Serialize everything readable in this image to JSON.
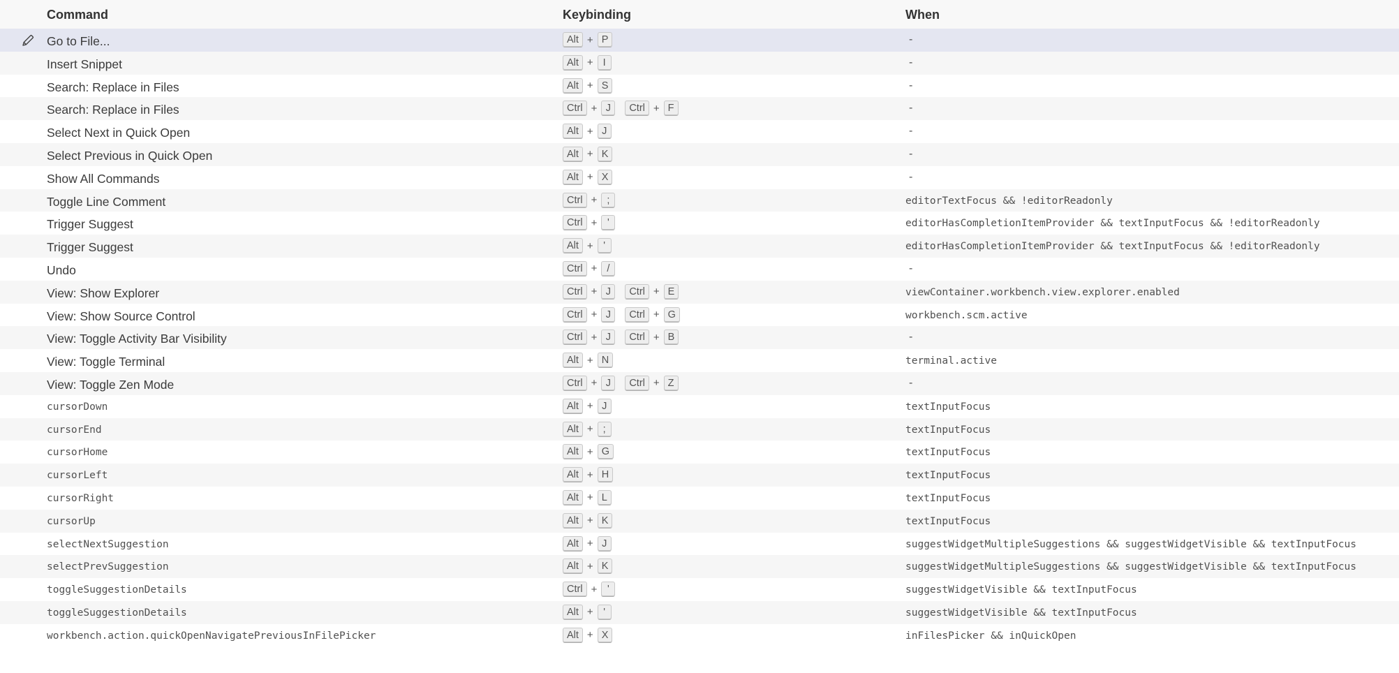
{
  "header": {
    "command": "Command",
    "keybinding": "Keybinding",
    "when": "When"
  },
  "rows": [
    {
      "command": "Go to File...",
      "mono": false,
      "chords": [
        [
          "Alt",
          "P"
        ]
      ],
      "when": "-"
    },
    {
      "command": "Insert Snippet",
      "mono": false,
      "chords": [
        [
          "Alt",
          "I"
        ]
      ],
      "when": "-"
    },
    {
      "command": "Search: Replace in Files",
      "mono": false,
      "chords": [
        [
          "Alt",
          "S"
        ]
      ],
      "when": "-"
    },
    {
      "command": "Search: Replace in Files",
      "mono": false,
      "chords": [
        [
          "Ctrl",
          "J"
        ],
        [
          "Ctrl",
          "F"
        ]
      ],
      "when": "-"
    },
    {
      "command": "Select Next in Quick Open",
      "mono": false,
      "chords": [
        [
          "Alt",
          "J"
        ]
      ],
      "when": "-"
    },
    {
      "command": "Select Previous in Quick Open",
      "mono": false,
      "chords": [
        [
          "Alt",
          "K"
        ]
      ],
      "when": "-"
    },
    {
      "command": "Show All Commands",
      "mono": false,
      "chords": [
        [
          "Alt",
          "X"
        ]
      ],
      "when": "-"
    },
    {
      "command": "Toggle Line Comment",
      "mono": false,
      "chords": [
        [
          "Ctrl",
          ";"
        ]
      ],
      "when": "editorTextFocus && !editorReadonly"
    },
    {
      "command": "Trigger Suggest",
      "mono": false,
      "chords": [
        [
          "Ctrl",
          "'"
        ]
      ],
      "when": "editorHasCompletionItemProvider && textInputFocus && !editorReadonly"
    },
    {
      "command": "Trigger Suggest",
      "mono": false,
      "chords": [
        [
          "Alt",
          "'"
        ]
      ],
      "when": "editorHasCompletionItemProvider && textInputFocus && !editorReadonly"
    },
    {
      "command": "Undo",
      "mono": false,
      "chords": [
        [
          "Ctrl",
          "/"
        ]
      ],
      "when": "-"
    },
    {
      "command": "View: Show Explorer",
      "mono": false,
      "chords": [
        [
          "Ctrl",
          "J"
        ],
        [
          "Ctrl",
          "E"
        ]
      ],
      "when": "viewContainer.workbench.view.explorer.enabled"
    },
    {
      "command": "View: Show Source Control",
      "mono": false,
      "chords": [
        [
          "Ctrl",
          "J"
        ],
        [
          "Ctrl",
          "G"
        ]
      ],
      "when": "workbench.scm.active"
    },
    {
      "command": "View: Toggle Activity Bar Visibility",
      "mono": false,
      "chords": [
        [
          "Ctrl",
          "J"
        ],
        [
          "Ctrl",
          "B"
        ]
      ],
      "when": "-"
    },
    {
      "command": "View: Toggle Terminal",
      "mono": false,
      "chords": [
        [
          "Alt",
          "N"
        ]
      ],
      "when": "terminal.active"
    },
    {
      "command": "View: Toggle Zen Mode",
      "mono": false,
      "chords": [
        [
          "Ctrl",
          "J"
        ],
        [
          "Ctrl",
          "Z"
        ]
      ],
      "when": "-"
    },
    {
      "command": "cursorDown",
      "mono": true,
      "chords": [
        [
          "Alt",
          "J"
        ]
      ],
      "when": "textInputFocus"
    },
    {
      "command": "cursorEnd",
      "mono": true,
      "chords": [
        [
          "Alt",
          ";"
        ]
      ],
      "when": "textInputFocus"
    },
    {
      "command": "cursorHome",
      "mono": true,
      "chords": [
        [
          "Alt",
          "G"
        ]
      ],
      "when": "textInputFocus"
    },
    {
      "command": "cursorLeft",
      "mono": true,
      "chords": [
        [
          "Alt",
          "H"
        ]
      ],
      "when": "textInputFocus"
    },
    {
      "command": "cursorRight",
      "mono": true,
      "chords": [
        [
          "Alt",
          "L"
        ]
      ],
      "when": "textInputFocus"
    },
    {
      "command": "cursorUp",
      "mono": true,
      "chords": [
        [
          "Alt",
          "K"
        ]
      ],
      "when": "textInputFocus"
    },
    {
      "command": "selectNextSuggestion",
      "mono": true,
      "chords": [
        [
          "Alt",
          "J"
        ]
      ],
      "when": "suggestWidgetMultipleSuggestions && suggestWidgetVisible && textInputFocus"
    },
    {
      "command": "selectPrevSuggestion",
      "mono": true,
      "chords": [
        [
          "Alt",
          "K"
        ]
      ],
      "when": "suggestWidgetMultipleSuggestions && suggestWidgetVisible && textInputFocus"
    },
    {
      "command": "toggleSuggestionDetails",
      "mono": true,
      "chords": [
        [
          "Ctrl",
          "'"
        ]
      ],
      "when": "suggestWidgetVisible && textInputFocus"
    },
    {
      "command": "toggleSuggestionDetails",
      "mono": true,
      "chords": [
        [
          "Alt",
          "'"
        ]
      ],
      "when": "suggestWidgetVisible && textInputFocus"
    },
    {
      "command": "workbench.action.quickOpenNavigatePreviousInFilePicker",
      "mono": true,
      "chords": [
        [
          "Alt",
          "X"
        ]
      ],
      "when": "inFilesPicker && inQuickOpen"
    }
  ],
  "icons": {
    "edit": "pencil-icon"
  },
  "colors": {
    "selected_row": "#e4e6f1",
    "alt_row": "#f6f6f6",
    "header_bg": "#f8f8f8"
  }
}
